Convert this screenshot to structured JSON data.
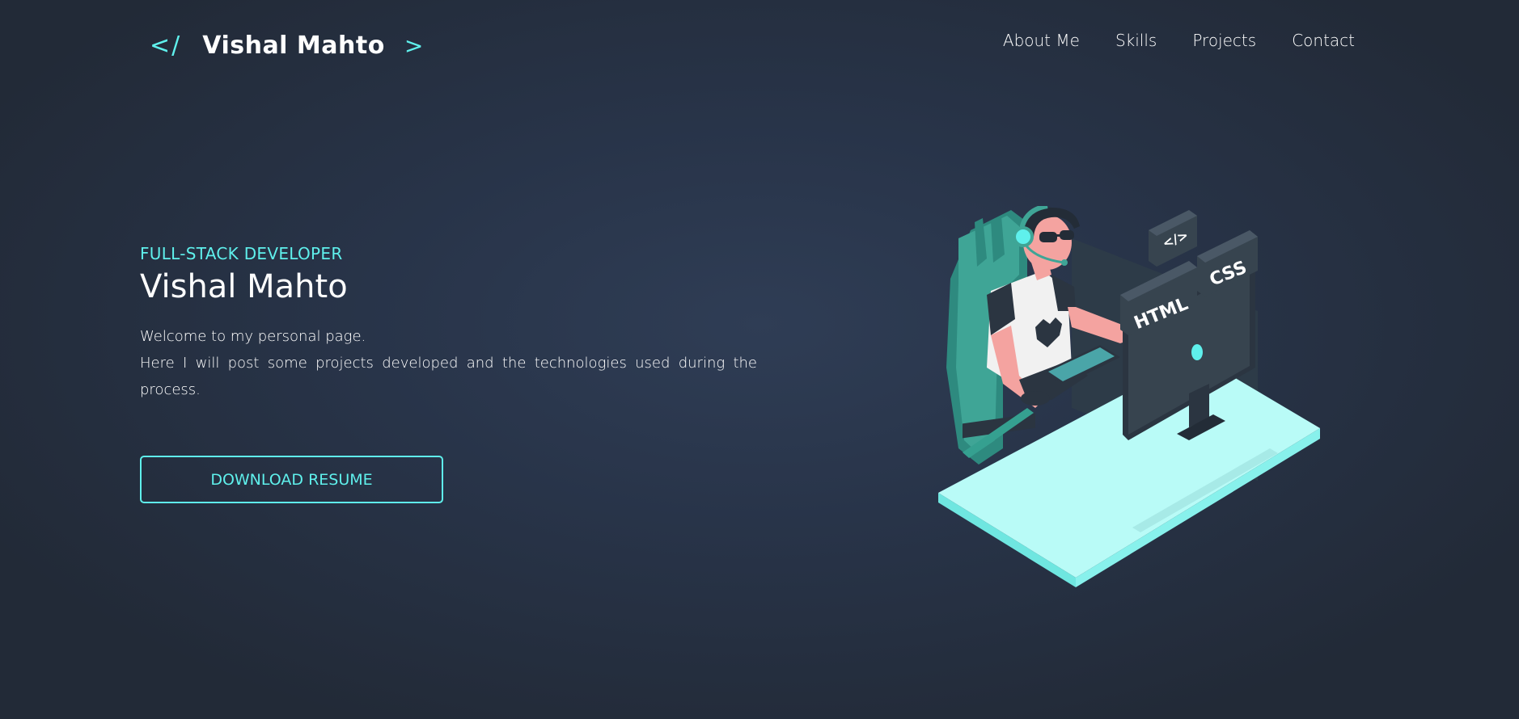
{
  "header": {
    "logo": {
      "open_bracket": "</",
      "name": "Vishal Mahto",
      "close_bracket": ">"
    },
    "nav": [
      {
        "label": "About Me"
      },
      {
        "label": "Skills"
      },
      {
        "label": "Projects"
      },
      {
        "label": "Contact"
      }
    ]
  },
  "hero": {
    "subtitle": "FULL-STACK DEVELOPER",
    "title": "Vishal Mahto",
    "description_line1": "Welcome to my personal page.",
    "description_line2": "Here I will post some projects developed and the technologies used during the process.",
    "button_label": "DOWNLOAD RESUME"
  },
  "illustration": {
    "code_tag_text": "</>",
    "html_tag_text": "HTML",
    "css_tag_text": "CSS"
  },
  "colors": {
    "accent": "#5ff0ec",
    "background": "#222a37",
    "text": "#ffffff"
  }
}
